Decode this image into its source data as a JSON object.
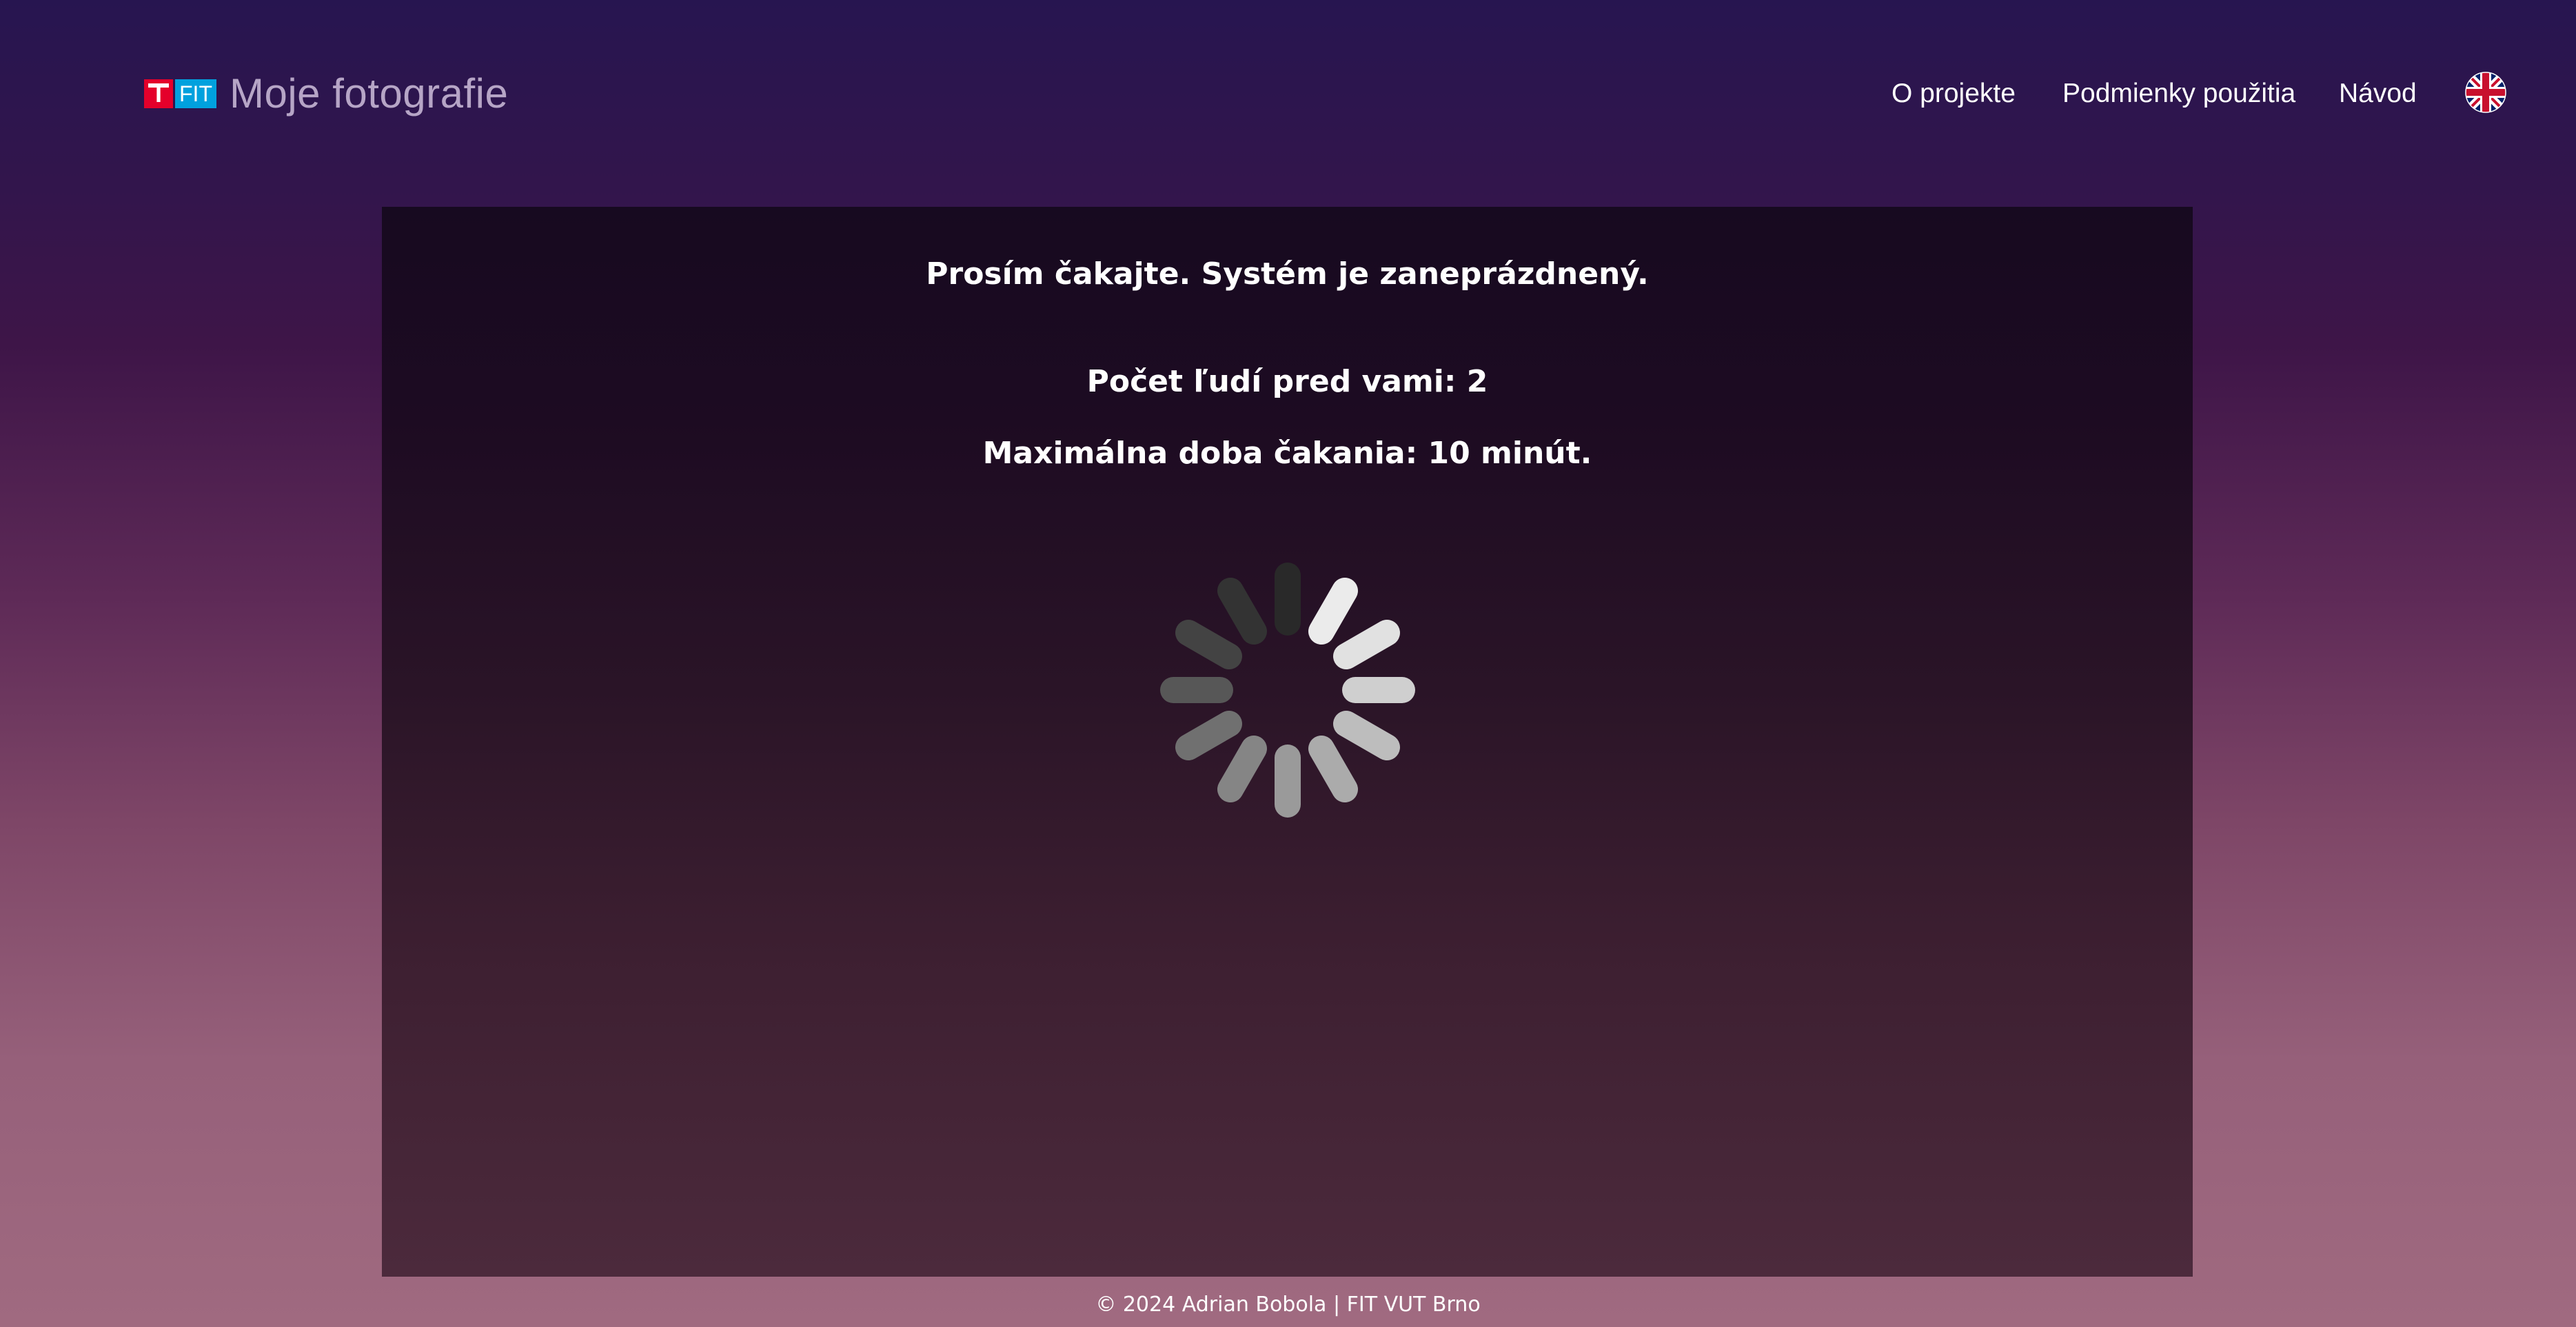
{
  "header": {
    "logo": {
      "mark": "T",
      "text": "FIT"
    },
    "title": "Moje fotografie",
    "nav": [
      {
        "label": "O projekte"
      },
      {
        "label": "Podmienky použitia"
      },
      {
        "label": "Návod"
      }
    ],
    "language_icon": "uk-flag-icon"
  },
  "main": {
    "wait_title": "Prosím čakajte. Systém je zaneprázdnený.",
    "queue_text": "Počet ľudí pred vami: 2",
    "max_wait_text": "Maximálna doba čakania: 10 minút.",
    "spinner_icon": "loading-spinner-icon"
  },
  "footer": {
    "text": "© 2024 Adrian Bobola | FIT VUT Brno"
  },
  "colors": {
    "logo_red": "#e4002b",
    "logo_blue": "#00a1de",
    "title_color": "#b6a5c6"
  }
}
